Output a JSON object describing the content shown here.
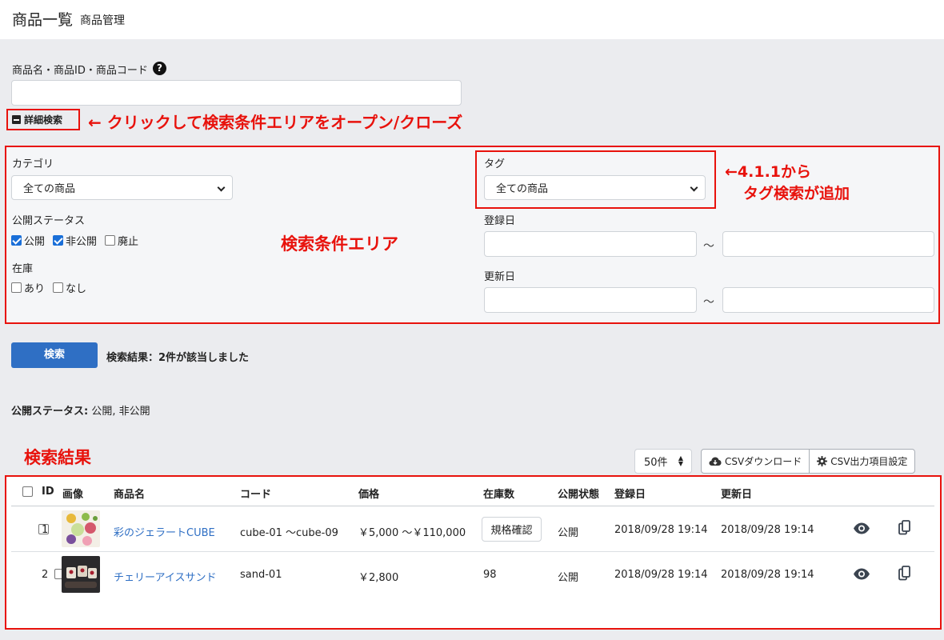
{
  "header": {
    "title": "商品一覧",
    "subtitle": "商品管理"
  },
  "search": {
    "keyword_label": "商品名・商品ID・商品コード",
    "help_icon": "?",
    "keyword_value": "",
    "detail_toggle_label": "詳細検索"
  },
  "annotations": {
    "toggle_note": "← クリックして検索条件エリアをオープン/クローズ",
    "tag_note_line1": "←4.1.1から",
    "tag_note_line2": "タグ検索が追加",
    "condition_area": "検索条件エリア",
    "results_area": "検索結果"
  },
  "conditions": {
    "category_label": "カテゴリ",
    "category_selected": "全ての商品",
    "status_label": "公開ステータス",
    "status_options": [
      {
        "label": "公開",
        "checked": true
      },
      {
        "label": "非公開",
        "checked": true
      },
      {
        "label": "廃止",
        "checked": false
      }
    ],
    "stock_label": "在庫",
    "stock_options": [
      {
        "label": "あり",
        "checked": false
      },
      {
        "label": "なし",
        "checked": false
      }
    ],
    "tag_label": "タグ",
    "tag_selected": "全ての商品",
    "registered_label": "登録日",
    "updated_label": "更新日",
    "range_separator": "～"
  },
  "actions": {
    "search_button": "検索",
    "results_summary": "検索結果：2件が該当しました",
    "status_summary_label": "公開ステータス:",
    "status_summary_value": " 公開, 非公開"
  },
  "toolbar": {
    "per_page": "50件",
    "csv_download": "CSVダウンロード",
    "csv_settings": "CSV出力項目設定"
  },
  "table": {
    "columns": [
      "ID",
      "画像",
      "商品名",
      "コード",
      "価格",
      "在庫数",
      "公開状態",
      "登録日",
      "更新日"
    ],
    "rows": [
      {
        "id": "1",
        "name": "彩のジェラートCUBE",
        "code": "cube-01 ～cube-09",
        "price": "￥5,000 ～￥110,000",
        "stock": "規格確認",
        "status": "公開",
        "registered": "2018/09/28 19:14",
        "updated": "2018/09/28 19:14"
      },
      {
        "id": "2",
        "name": "チェリーアイスサンド",
        "code": "sand-01",
        "price": "￥2,800",
        "stock": "98",
        "status": "公開",
        "registered": "2018/09/28 19:14",
        "updated": "2018/09/28 19:14"
      }
    ]
  },
  "colors": {
    "accent": "#2f6fc4",
    "annotation": "#e8120c",
    "background": "#ebecef"
  }
}
